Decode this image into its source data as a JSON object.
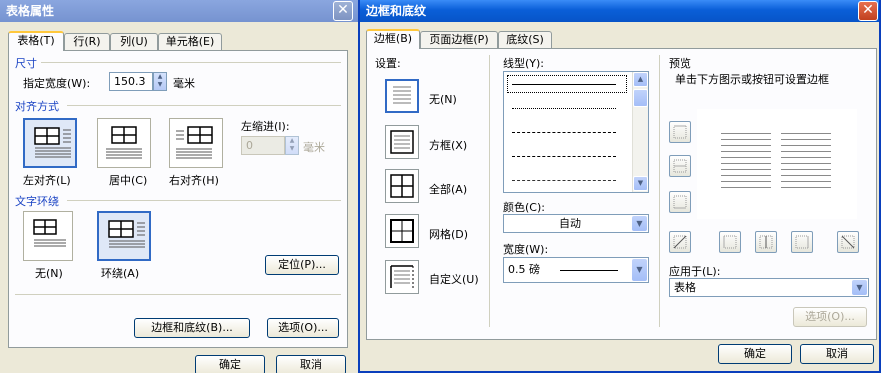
{
  "table_properties": {
    "title": "表格属性",
    "tabs": [
      "表格(T)",
      "行(R)",
      "列(U)",
      "单元格(E)"
    ],
    "size": {
      "group_label": "尺寸",
      "width_label": "指定宽度(W):",
      "width_value": "150.3",
      "width_unit": "毫米"
    },
    "alignment": {
      "group_label": "对齐方式",
      "options": [
        "左对齐(L)",
        "居中(C)",
        "右对齐(H)"
      ],
      "selected": "左对齐(L)",
      "indent_label": "左缩进(I):",
      "indent_value": "0",
      "indent_unit": "毫米"
    },
    "wrapping": {
      "group_label": "文字环绕",
      "options": [
        "无(N)",
        "环绕(A)"
      ],
      "selected": "环绕(A)"
    },
    "position_button": "定位(P)...",
    "borders_button": "边框和底纹(B)...",
    "options_button": "选项(O)...",
    "ok_button": "确定",
    "cancel_button": "取消"
  },
  "borders_shading": {
    "title": "边框和底纹",
    "tabs": [
      "边框(B)",
      "页面边框(P)",
      "底纹(S)"
    ],
    "setting": {
      "label": "设置:",
      "options": [
        "无(N)",
        "方框(X)",
        "全部(A)",
        "网格(D)",
        "自定义(U)"
      ],
      "selected": "无(N)"
    },
    "line_style_label": "线型(Y):",
    "line_styles": [
      "solid",
      "dotted-fine",
      "dashed-short",
      "dash-dot",
      "dash-long"
    ],
    "color_label": "颜色(C):",
    "color_value": "自动",
    "width_label": "宽度(W):",
    "width_value": "0.5  磅",
    "preview": {
      "label": "预览",
      "hint": "单击下方图示或按钮可设置边框"
    },
    "apply_to_label": "应用于(L):",
    "apply_to_value": "表格",
    "options_button": "选项(O)...",
    "ok_button": "确定",
    "cancel_button": "取消"
  },
  "colors": {
    "title_bar": "#0a5fd8",
    "group_label": "#1a43c4",
    "dialog_bg": "#ece9d8",
    "selected_border": "#316ac5"
  }
}
